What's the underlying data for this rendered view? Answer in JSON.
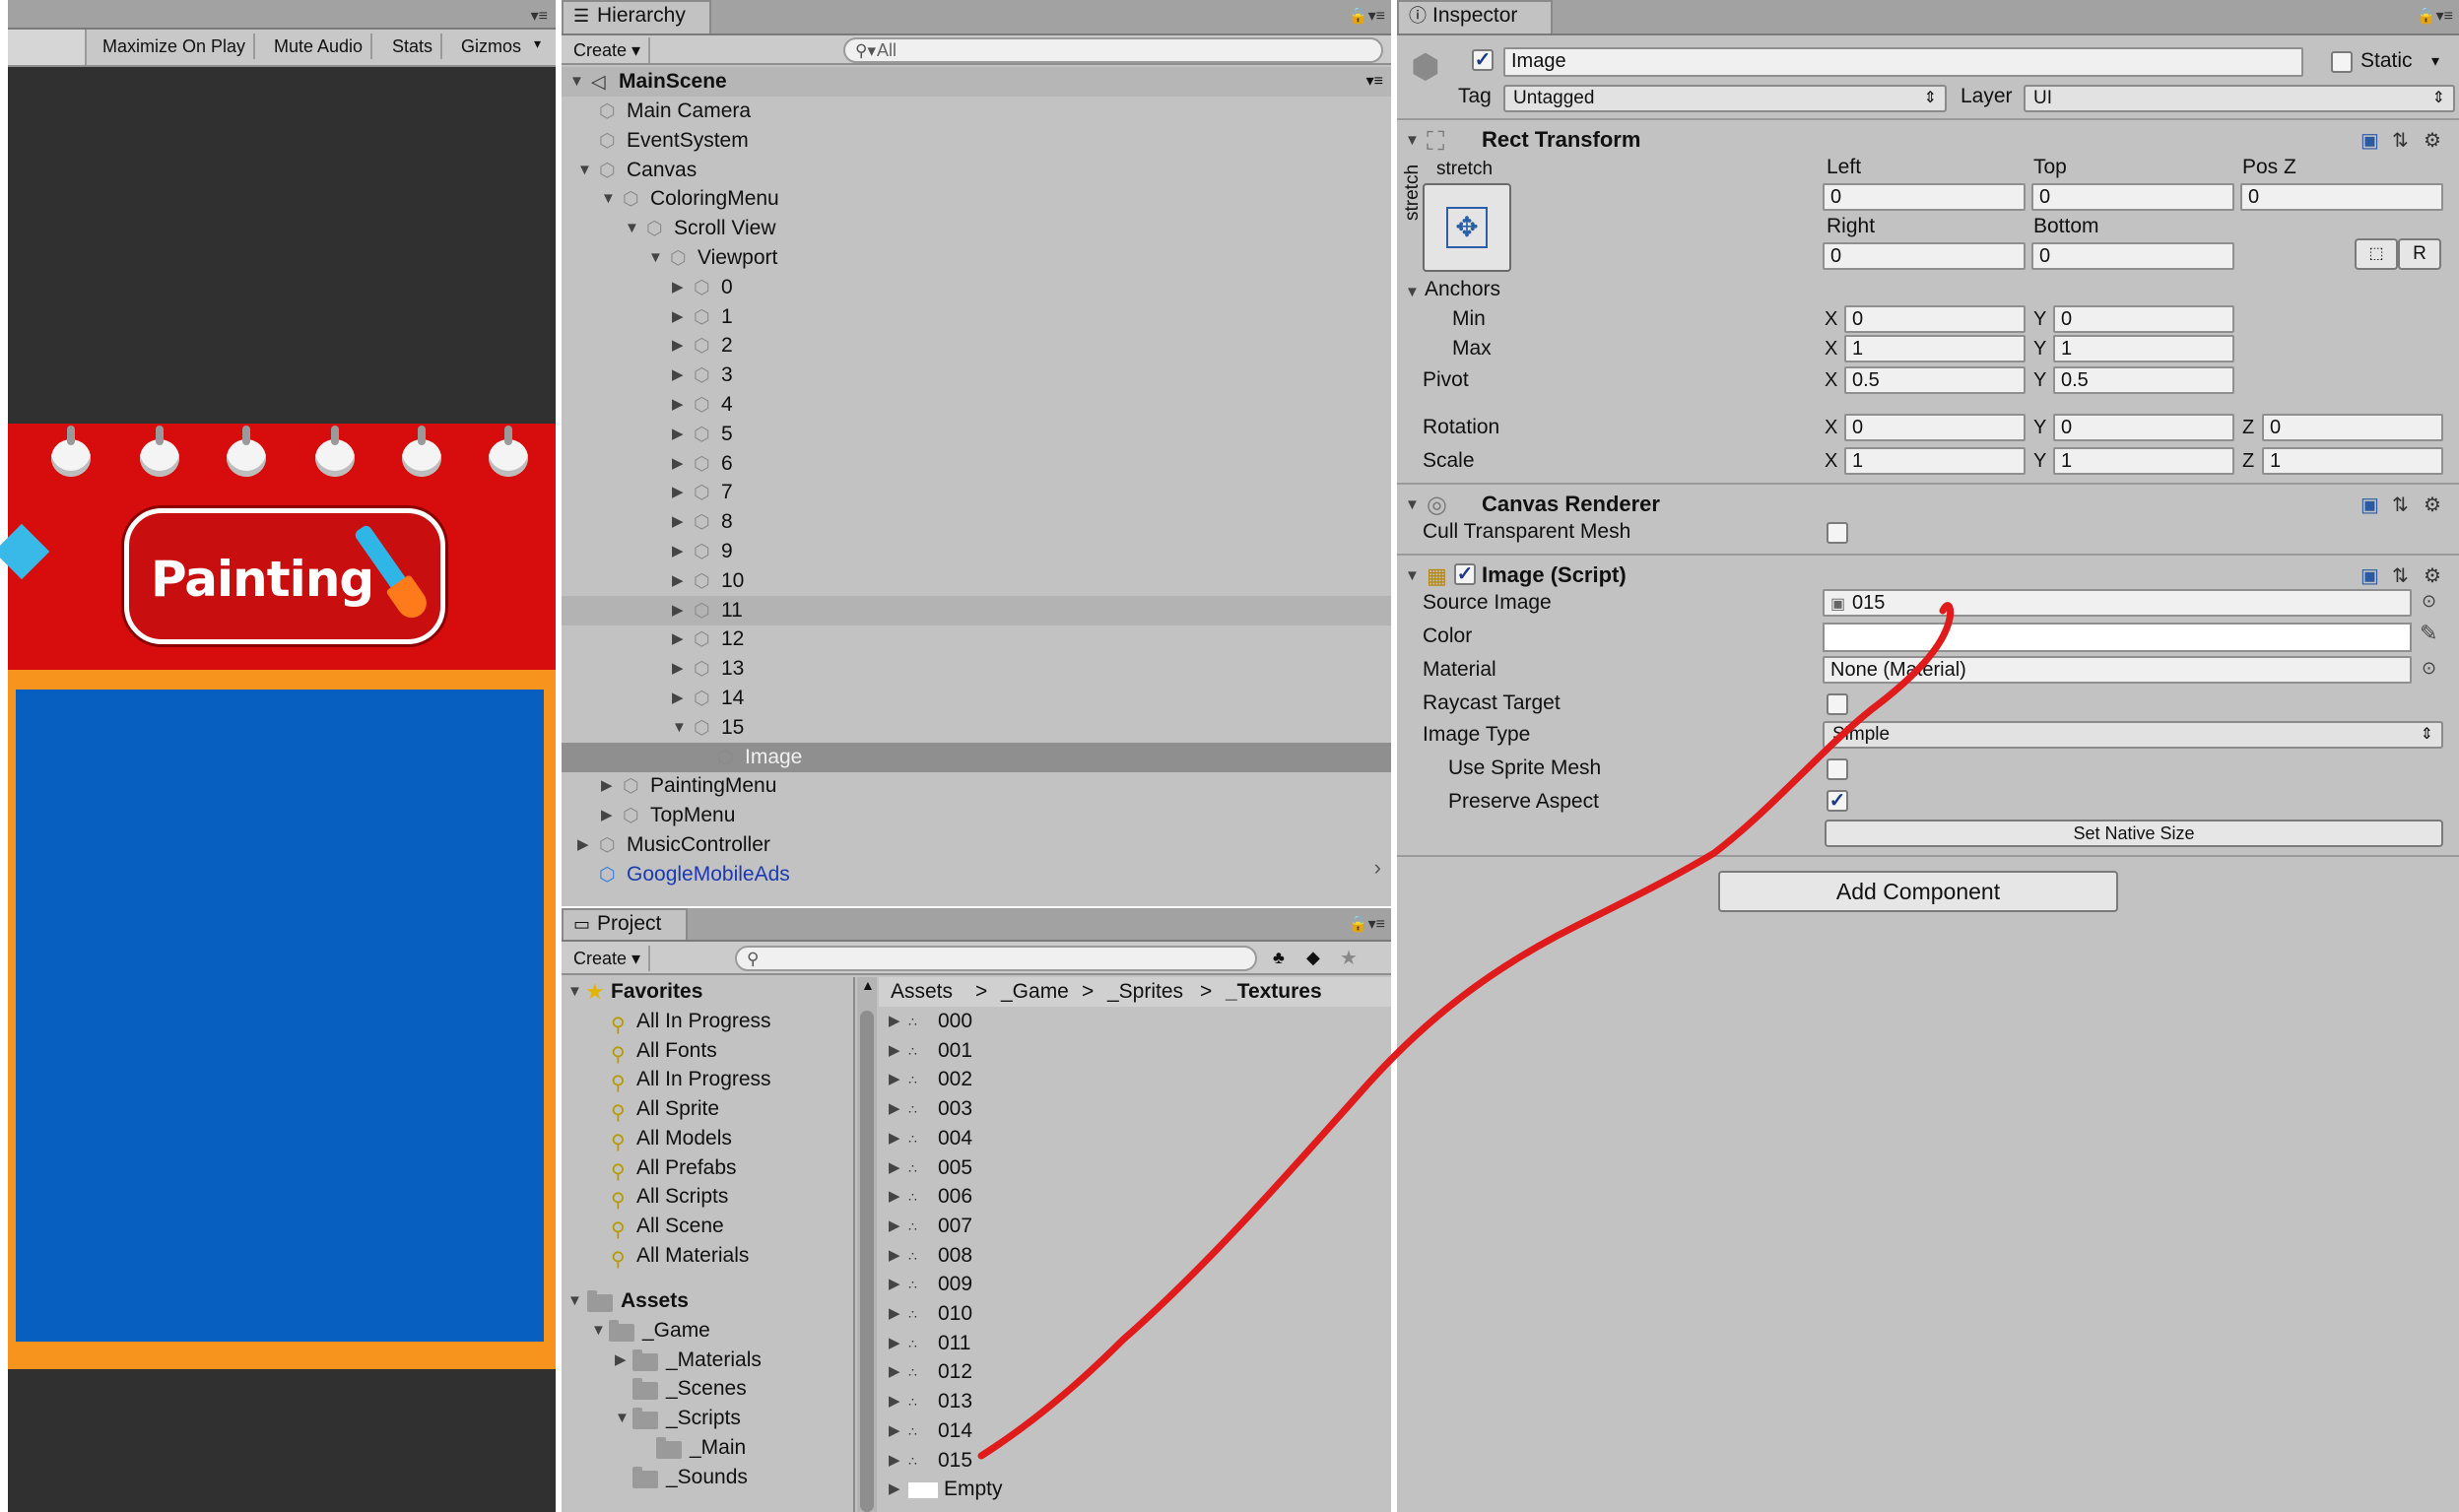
{
  "game_toolbar": {
    "buttons": [
      "Maximize On Play",
      "Mute Audio",
      "Stats",
      "Gizmos"
    ]
  },
  "game_view": {
    "button_label": "Painting"
  },
  "hierarchy": {
    "tab": "Hierarchy",
    "create": "Create",
    "search_placeholder": "All",
    "scene": "MainScene",
    "items": [
      {
        "label": "Main Camera"
      },
      {
        "label": "EventSystem"
      },
      {
        "label": "Canvas"
      },
      {
        "label": "ColoringMenu"
      },
      {
        "label": "Scroll View"
      },
      {
        "label": "Viewport"
      },
      {
        "label": "0"
      },
      {
        "label": "1"
      },
      {
        "label": "2"
      },
      {
        "label": "3"
      },
      {
        "label": "4"
      },
      {
        "label": "5"
      },
      {
        "label": "6"
      },
      {
        "label": "7"
      },
      {
        "label": "8"
      },
      {
        "label": "9"
      },
      {
        "label": "10"
      },
      {
        "label": "11"
      },
      {
        "label": "12"
      },
      {
        "label": "13"
      },
      {
        "label": "14"
      },
      {
        "label": "15"
      },
      {
        "label": "Image"
      },
      {
        "label": "PaintingMenu"
      },
      {
        "label": "TopMenu"
      },
      {
        "label": "MusicController"
      },
      {
        "label": "GoogleMobileAds"
      }
    ]
  },
  "project": {
    "tab": "Project",
    "create": "Create",
    "favorites_title": "Favorites",
    "favorites": [
      "All In Progress",
      "All Fonts",
      "All In Progress",
      "All Sprite",
      "All Models",
      "All Prefabs",
      "All Scripts",
      "All Scene",
      "All Materials"
    ],
    "assets_title": "Assets",
    "folders": [
      "_Game",
      "_Materials",
      "_Scenes",
      "_Scripts",
      "_Main",
      "_Sounds"
    ],
    "breadcrumb": [
      "Assets",
      "_Game",
      "_Sprites",
      "_Textures"
    ],
    "assets": [
      "000",
      "001",
      "002",
      "003",
      "004",
      "005",
      "006",
      "007",
      "008",
      "009",
      "010",
      "011",
      "012",
      "013",
      "014",
      "015",
      "Empty"
    ]
  },
  "inspector": {
    "tab": "Inspector",
    "object_name": "Image",
    "static_label": "Static",
    "tag_label": "Tag",
    "tag_value": "Untagged",
    "layer_label": "Layer",
    "layer_value": "UI",
    "rect_transform": {
      "title": "Rect Transform",
      "stretch_h": "stretch",
      "stretch_v": "stretch",
      "left_label": "Left",
      "top_label": "Top",
      "posz_label": "Pos Z",
      "left": "0",
      "top": "0",
      "posz": "0",
      "right_label": "Right",
      "bottom_label": "Bottom",
      "right": "0",
      "bottom": "0",
      "r_button": "R",
      "anchors_label": "Anchors",
      "min_label": "Min",
      "min_x": "0",
      "min_y": "0",
      "max_label": "Max",
      "max_x": "1",
      "max_y": "1",
      "pivot_label": "Pivot",
      "pivot_x": "0.5",
      "pivot_y": "0.5",
      "rotation_label": "Rotation",
      "rot_x": "0",
      "rot_y": "0",
      "rot_z": "0",
      "scale_label": "Scale",
      "scale_x": "1",
      "scale_y": "1",
      "scale_z": "1",
      "x": "X",
      "y": "Y",
      "z": "Z"
    },
    "canvas_renderer": {
      "title": "Canvas Renderer",
      "cull_label": "Cull Transparent Mesh"
    },
    "image_script": {
      "title": "Image (Script)",
      "source_label": "Source Image",
      "source_value": "015",
      "color_label": "Color",
      "material_label": "Material",
      "material_value": "None (Material)",
      "raycast_label": "Raycast Target",
      "type_label": "Image Type",
      "type_value": "Simple",
      "sprite_mesh_label": "Use Sprite Mesh",
      "preserve_label": "Preserve Aspect",
      "native_button": "Set Native Size"
    },
    "add_component": "Add Component"
  },
  "colors": {
    "panel_bg": "#c2c2c2",
    "selection": "#8f8f8f",
    "prefab_blue": "#1a3ab0",
    "annotation_red": "#e01b1b",
    "game_red": "#d70c0c",
    "game_blue": "#0760bf",
    "game_orange": "#f7941d"
  }
}
